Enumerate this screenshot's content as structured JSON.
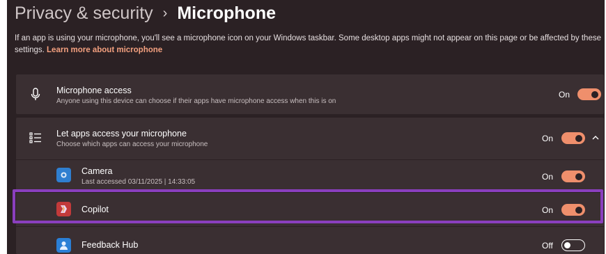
{
  "breadcrumb": {
    "parent": "Privacy & security",
    "separator": "›",
    "current": "Microphone"
  },
  "description": {
    "text": "If an app is using your microphone, you'll see a microphone icon on your Windows taskbar. Some desktop apps might not appear on this page or be affected by these settings.",
    "link": "Learn more about microphone"
  },
  "mic_access": {
    "title": "Microphone access",
    "subtitle": "Anyone using this device can choose if their apps have microphone access when this is on",
    "state": "On",
    "icon": "microphone-icon"
  },
  "let_apps": {
    "title": "Let apps access your microphone",
    "subtitle": "Choose which apps can access your microphone",
    "state": "On",
    "icon": "list-icon",
    "expand_icon": "chevron-up-icon"
  },
  "apps": [
    {
      "name": "Camera",
      "detail": "Last accessed 03/11/2025  |  14:33:05",
      "state": "On",
      "icon": "camera-app-icon"
    },
    {
      "name": "Copilot",
      "detail": "",
      "state": "On",
      "icon": "copilot-app-icon"
    },
    {
      "name": "Feedback Hub",
      "detail": "",
      "state": "Off",
      "icon": "feedback-hub-app-icon"
    }
  ],
  "colors": {
    "accent": "#ef8f6c",
    "highlight": "#8a3fbe",
    "background": "#2b2124",
    "card": "#3a2f32"
  }
}
